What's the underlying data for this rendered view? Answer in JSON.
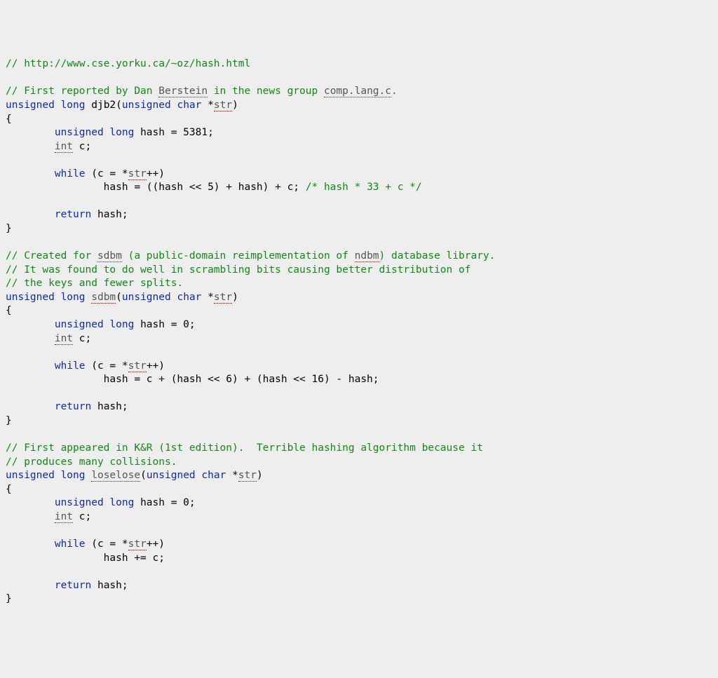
{
  "lines": [
    {
      "t": "cm",
      "s": "// http://www.cse.yorku.ca/~oz/hash.html"
    },
    {
      "t": "blank",
      "s": ""
    },
    {
      "t": "mix",
      "parts": [
        {
          "c": "cm",
          "s": "// First reported by Dan "
        },
        {
          "c": "cm sq",
          "s": "Berstein"
        },
        {
          "c": "cm",
          "s": " in the news group "
        },
        {
          "c": "cm sq",
          "s": "comp.lang.c"
        },
        {
          "c": "cm",
          "s": "."
        }
      ]
    },
    {
      "t": "mix",
      "parts": [
        {
          "c": "kw",
          "s": "unsigned"
        },
        {
          "c": "pl",
          "s": " "
        },
        {
          "c": "kw",
          "s": "long"
        },
        {
          "c": "pl",
          "s": " djb2("
        },
        {
          "c": "kw",
          "s": "unsigned"
        },
        {
          "c": "pl",
          "s": " "
        },
        {
          "c": "kw",
          "s": "char"
        },
        {
          "c": "pl",
          "s": " *"
        },
        {
          "c": "sq",
          "s": "str"
        },
        {
          "c": "pl",
          "s": ")"
        }
      ]
    },
    {
      "t": "pl",
      "s": "{"
    },
    {
      "t": "mix",
      "parts": [
        {
          "c": "pl",
          "s": "        "
        },
        {
          "c": "kw",
          "s": "unsigned"
        },
        {
          "c": "pl",
          "s": " "
        },
        {
          "c": "kw",
          "s": "long"
        },
        {
          "c": "pl",
          "s": " hash = 5381;"
        }
      ]
    },
    {
      "t": "mix",
      "parts": [
        {
          "c": "pl",
          "s": "        "
        },
        {
          "c": "kw sq",
          "s": "int"
        },
        {
          "c": "pl",
          "s": " c;"
        }
      ]
    },
    {
      "t": "blank",
      "s": ""
    },
    {
      "t": "mix",
      "parts": [
        {
          "c": "pl",
          "s": "        "
        },
        {
          "c": "kw",
          "s": "while"
        },
        {
          "c": "pl",
          "s": " (c = *"
        },
        {
          "c": "sq",
          "s": "str"
        },
        {
          "c": "pl",
          "s": "++)"
        }
      ]
    },
    {
      "t": "mix",
      "parts": [
        {
          "c": "pl",
          "s": "                hash = ((hash << 5) + hash) + c; "
        },
        {
          "c": "cm",
          "s": "/* hash * 33 + c */"
        }
      ]
    },
    {
      "t": "blank",
      "s": ""
    },
    {
      "t": "mix",
      "parts": [
        {
          "c": "pl",
          "s": "        "
        },
        {
          "c": "kw",
          "s": "return"
        },
        {
          "c": "pl",
          "s": " hash;"
        }
      ]
    },
    {
      "t": "pl",
      "s": "}"
    },
    {
      "t": "blank",
      "s": ""
    },
    {
      "t": "mix",
      "parts": [
        {
          "c": "cm",
          "s": "// Created for "
        },
        {
          "c": "cm sq",
          "s": "sdbm"
        },
        {
          "c": "cm",
          "s": " (a public-domain reimplementation of "
        },
        {
          "c": "cm sq",
          "s": "ndbm"
        },
        {
          "c": "cm",
          "s": ") database library."
        }
      ]
    },
    {
      "t": "cm",
      "s": "// It was found to do well in scrambling bits causing better distribution of"
    },
    {
      "t": "cm",
      "s": "// the keys and fewer splits."
    },
    {
      "t": "mix",
      "parts": [
        {
          "c": "kw",
          "s": "unsigned"
        },
        {
          "c": "pl",
          "s": " "
        },
        {
          "c": "kw",
          "s": "long"
        },
        {
          "c": "pl",
          "s": " "
        },
        {
          "c": "sq",
          "s": "sdbm"
        },
        {
          "c": "pl",
          "s": "("
        },
        {
          "c": "kw",
          "s": "unsigned"
        },
        {
          "c": "pl",
          "s": " "
        },
        {
          "c": "kw",
          "s": "char"
        },
        {
          "c": "pl",
          "s": " *"
        },
        {
          "c": "sq",
          "s": "str"
        },
        {
          "c": "pl",
          "s": ")"
        }
      ]
    },
    {
      "t": "pl",
      "s": "{"
    },
    {
      "t": "mix",
      "parts": [
        {
          "c": "pl",
          "s": "        "
        },
        {
          "c": "kw",
          "s": "unsigned"
        },
        {
          "c": "pl",
          "s": " "
        },
        {
          "c": "kw",
          "s": "long"
        },
        {
          "c": "pl",
          "s": " hash = 0;"
        }
      ]
    },
    {
      "t": "mix",
      "parts": [
        {
          "c": "pl",
          "s": "        "
        },
        {
          "c": "kw sq",
          "s": "int"
        },
        {
          "c": "pl",
          "s": " c;"
        }
      ]
    },
    {
      "t": "blank",
      "s": ""
    },
    {
      "t": "mix",
      "parts": [
        {
          "c": "pl",
          "s": "        "
        },
        {
          "c": "kw",
          "s": "while"
        },
        {
          "c": "pl",
          "s": " (c = *"
        },
        {
          "c": "sq",
          "s": "str"
        },
        {
          "c": "pl",
          "s": "++)"
        }
      ]
    },
    {
      "t": "pl",
      "s": "                hash = c + (hash << 6) + (hash << 16) - hash;"
    },
    {
      "t": "blank",
      "s": ""
    },
    {
      "t": "mix",
      "parts": [
        {
          "c": "pl",
          "s": "        "
        },
        {
          "c": "kw",
          "s": "return"
        },
        {
          "c": "pl",
          "s": " hash;"
        }
      ]
    },
    {
      "t": "pl",
      "s": "}"
    },
    {
      "t": "blank",
      "s": ""
    },
    {
      "t": "cm",
      "s": "// First appeared in K&R (1st edition).  Terrible hashing algorithm because it"
    },
    {
      "t": "cm",
      "s": "// produces many collisions."
    },
    {
      "t": "mix",
      "parts": [
        {
          "c": "kw",
          "s": "unsigned"
        },
        {
          "c": "pl",
          "s": " "
        },
        {
          "c": "kw",
          "s": "long"
        },
        {
          "c": "pl",
          "s": " "
        },
        {
          "c": "sq",
          "s": "loselose"
        },
        {
          "c": "pl",
          "s": "("
        },
        {
          "c": "kw",
          "s": "unsigned"
        },
        {
          "c": "pl",
          "s": " "
        },
        {
          "c": "kw",
          "s": "char"
        },
        {
          "c": "pl",
          "s": " *"
        },
        {
          "c": "sq",
          "s": "str"
        },
        {
          "c": "pl",
          "s": ")"
        }
      ]
    },
    {
      "t": "pl",
      "s": "{"
    },
    {
      "t": "mix",
      "parts": [
        {
          "c": "pl",
          "s": "        "
        },
        {
          "c": "kw",
          "s": "unsigned"
        },
        {
          "c": "pl",
          "s": " "
        },
        {
          "c": "kw",
          "s": "long"
        },
        {
          "c": "pl",
          "s": " hash = 0;"
        }
      ]
    },
    {
      "t": "mix",
      "parts": [
        {
          "c": "pl",
          "s": "        "
        },
        {
          "c": "kw sq",
          "s": "int"
        },
        {
          "c": "pl",
          "s": " c;"
        }
      ]
    },
    {
      "t": "blank",
      "s": ""
    },
    {
      "t": "mix",
      "parts": [
        {
          "c": "pl",
          "s": "        "
        },
        {
          "c": "kw",
          "s": "while"
        },
        {
          "c": "pl",
          "s": " (c = *"
        },
        {
          "c": "sq",
          "s": "str"
        },
        {
          "c": "pl",
          "s": "++)"
        }
      ]
    },
    {
      "t": "pl",
      "s": "                hash += c;"
    },
    {
      "t": "blank",
      "s": ""
    },
    {
      "t": "mix",
      "parts": [
        {
          "c": "pl",
          "s": "        "
        },
        {
          "c": "kw",
          "s": "return"
        },
        {
          "c": "pl",
          "s": " hash;"
        }
      ]
    },
    {
      "t": "pl",
      "s": "}"
    }
  ]
}
